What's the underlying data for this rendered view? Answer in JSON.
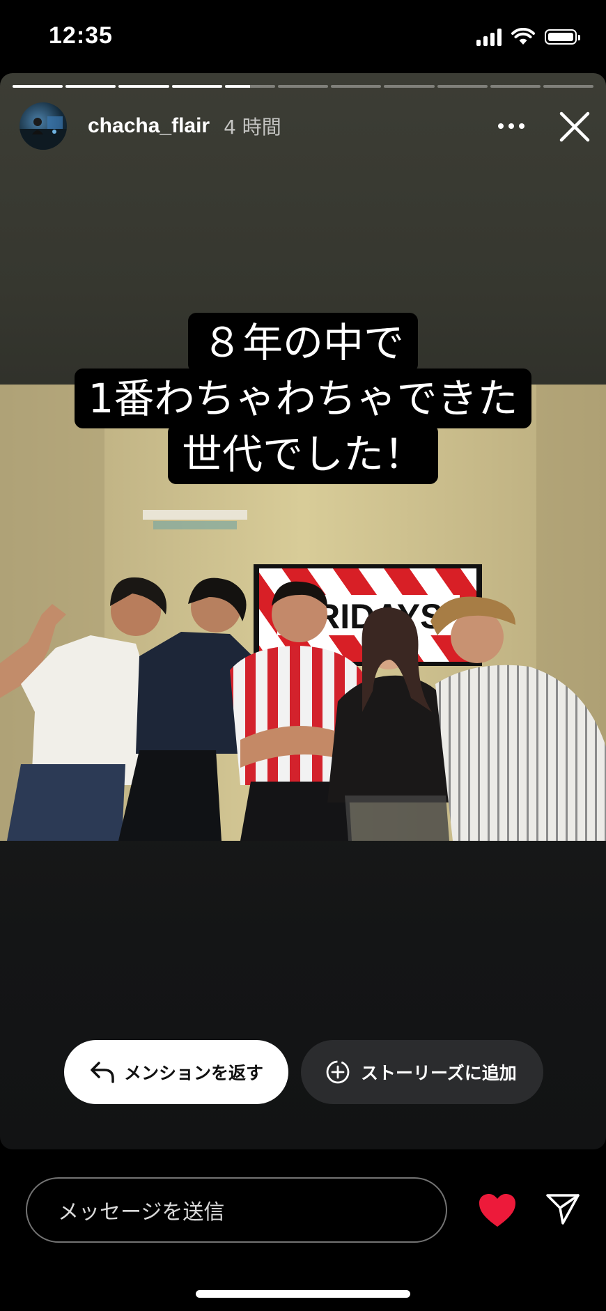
{
  "status_bar": {
    "time": "12:35"
  },
  "story": {
    "progress": {
      "segment_count": 11,
      "current_index": 4,
      "current_fraction": 0.5
    },
    "header": {
      "username": "chacha_flair",
      "time_ago": "4 時間"
    },
    "caption": {
      "line1": "８年の中で",
      "line2": "1番わちゃわちゃできた",
      "line3": "世代でした！"
    },
    "photo": {
      "sign_text": "FRIDAYS"
    },
    "actions": {
      "mention_label": "メンションを返す",
      "add_story_label": "ストーリーズに追加"
    }
  },
  "message_bar": {
    "placeholder": "メッセージを送信"
  },
  "colors": {
    "heart": "#ed1a3a",
    "story_top": "#3c3d35",
    "story_bottom": "#121314"
  }
}
